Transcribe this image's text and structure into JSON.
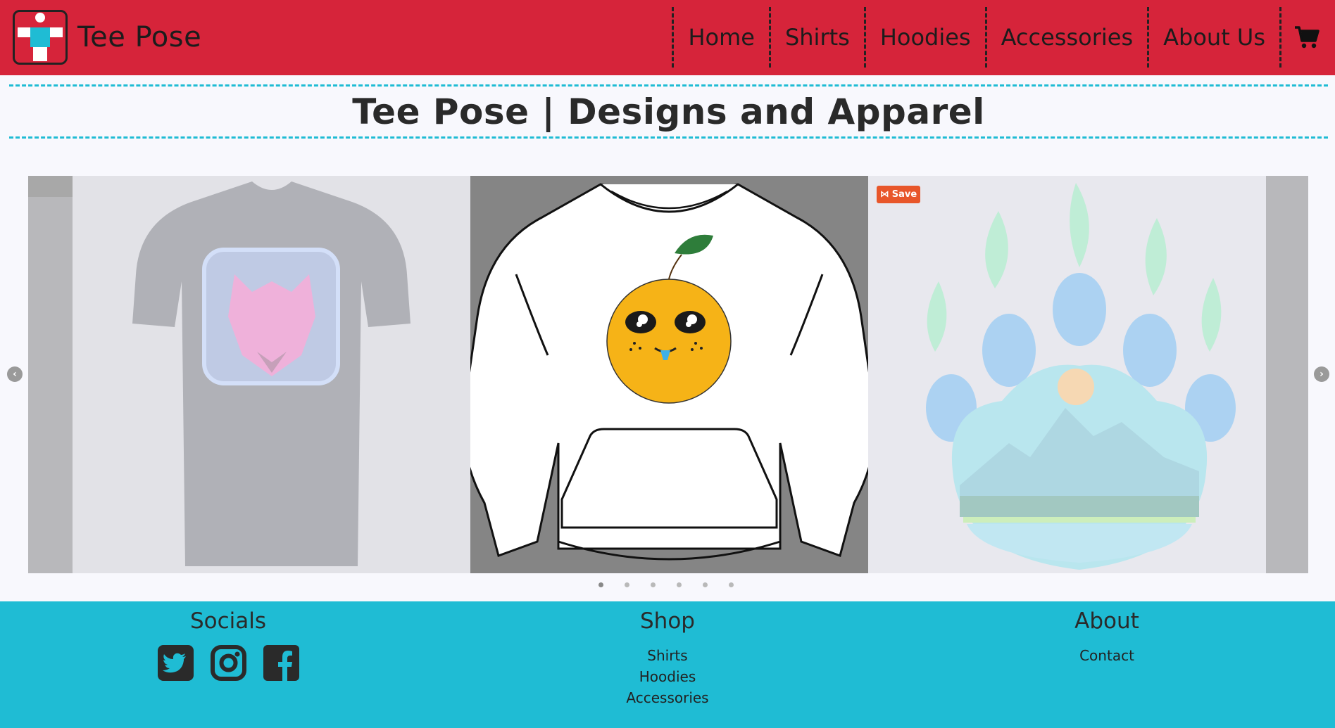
{
  "header": {
    "brand_name": "Tee Pose",
    "nav": [
      "Home",
      "Shirts",
      "Hoodies",
      "Accessories",
      "About Us"
    ],
    "cart_icon": "shopping-cart-icon"
  },
  "page_title": "Tee Pose | Designs and Apparel",
  "carousel": {
    "slides": [
      "cat-graphic-tshirt",
      "orange-graphic-hoodie",
      "bear-paw-landscape-design"
    ],
    "save_label": "Save",
    "dot_count": 6,
    "active_dot": 0
  },
  "footer": {
    "socials": {
      "heading": "Socials",
      "icons": [
        "twitter-icon",
        "instagram-icon",
        "facebook-icon"
      ]
    },
    "shop": {
      "heading": "Shop",
      "links": [
        "Shirts",
        "Hoodies",
        "Accessories"
      ]
    },
    "about": {
      "heading": "About",
      "links": [
        "Contact"
      ]
    }
  },
  "colors": {
    "header": "#d6243a",
    "accent": "#1fbcd4",
    "footer": "#1fbcd4",
    "save_badge": "#e8562a"
  }
}
